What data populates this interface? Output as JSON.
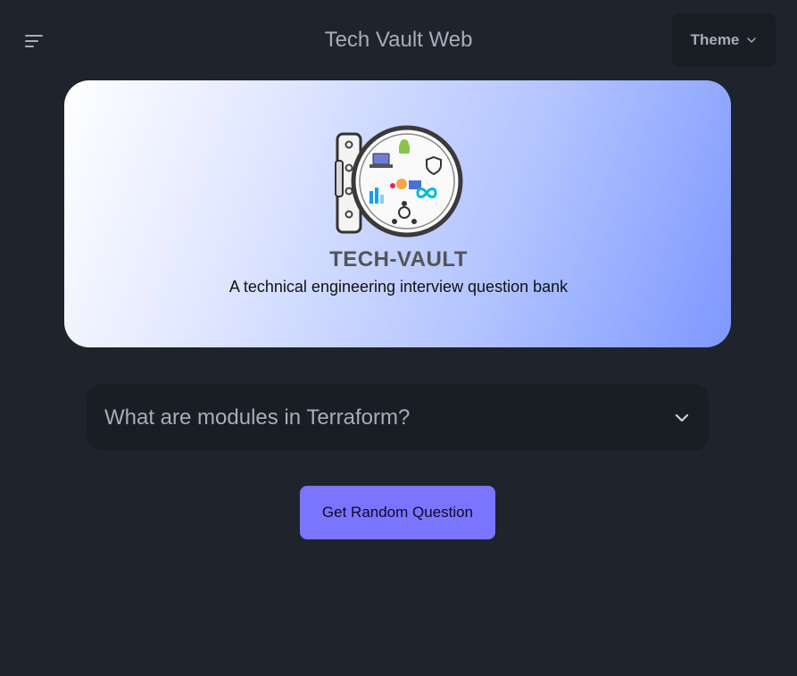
{
  "header": {
    "menu_icon": "hamburger-menu-icon",
    "title": "Tech Vault Web",
    "theme_label": "Theme",
    "theme_icon": "chevron-down-icon"
  },
  "hero": {
    "logo_icon": "vault-door-logo",
    "title": "TECH-VAULT",
    "subtitle": "A technical engineering interview question bank"
  },
  "question": {
    "text": "What are modules in Terraform?",
    "icon": "chevron-down-icon"
  },
  "actions": {
    "random_label": "Get Random Question"
  },
  "colors": {
    "background": "#1f232b",
    "surface": "#191d24",
    "text": "#a6adbb",
    "primary": "#7b74ff"
  }
}
